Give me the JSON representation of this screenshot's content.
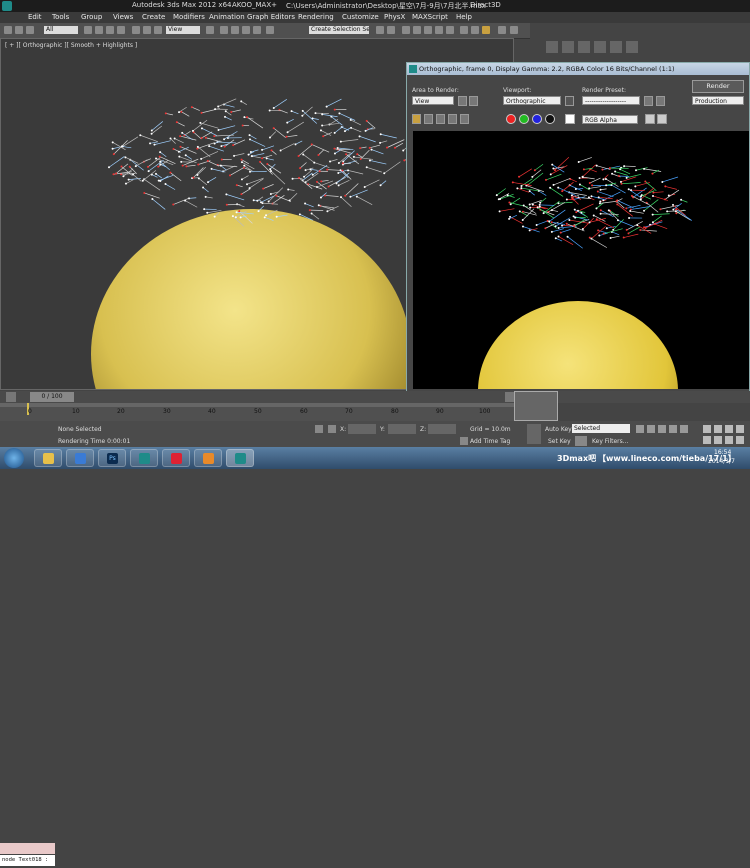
{
  "titlebar": {
    "app_title": "Autodesk 3ds Max  2012 x64",
    "workspace": "AKOO_MAX+",
    "file_path": "C:\\Users\\Administrator\\Desktop\\星空\\7月-9月\\7月北半.max",
    "renderer": "Direct3D"
  },
  "menubar": {
    "items": [
      "Edit",
      "Tools",
      "Group",
      "Views",
      "Create",
      "Modifiers",
      "Animation",
      "Graph Editors",
      "Rendering",
      "Customize",
      "PhysX",
      "MAXScript",
      "Help"
    ]
  },
  "toolbar": {
    "filter_value": "All",
    "refcoord_value": "View",
    "selection_set_value": "Create Selection Se"
  },
  "viewport": {
    "label": "[ + ][ Orthographic ][ Smooth + Highlights ]"
  },
  "render_window": {
    "title": "Orthographic, frame 0, Display Gamma: 2.2, RGBA Color 16 Bits/Channel (1:1)",
    "area_label": "Area to Render:",
    "area_value": "View",
    "viewport_label": "Viewport:",
    "viewport_value": "Orthographic",
    "preset_label": "Render Preset:",
    "preset_value": "-------------------",
    "render_button": "Render",
    "production_value": "Production",
    "channel_value": "RGB Alpha"
  },
  "timeline": {
    "slider_label": "0 / 100",
    "ticks": [
      "0",
      "10",
      "20",
      "30",
      "40",
      "50",
      "60",
      "70",
      "80",
      "90",
      "100"
    ]
  },
  "status": {
    "maxscript_text": "node Text018 :",
    "selection_text": "None Selected",
    "render_time": "Rendering Time  0:00:01",
    "x_label": "X:",
    "y_label": "Y:",
    "z_label": "Z:",
    "grid": "Grid = 10.0m",
    "add_time_tag": "Add Time Tag",
    "auto_key": "Auto Key",
    "auto_key_value": "Selected",
    "set_key": "Set Key",
    "key_filters": "Key Filters..."
  },
  "taskbar": {
    "watermark": "3Dmax吧",
    "url": "【www.lineco.com/tieba/17/1】",
    "clock_time": "16:54",
    "clock_date": "2014/1/7"
  }
}
